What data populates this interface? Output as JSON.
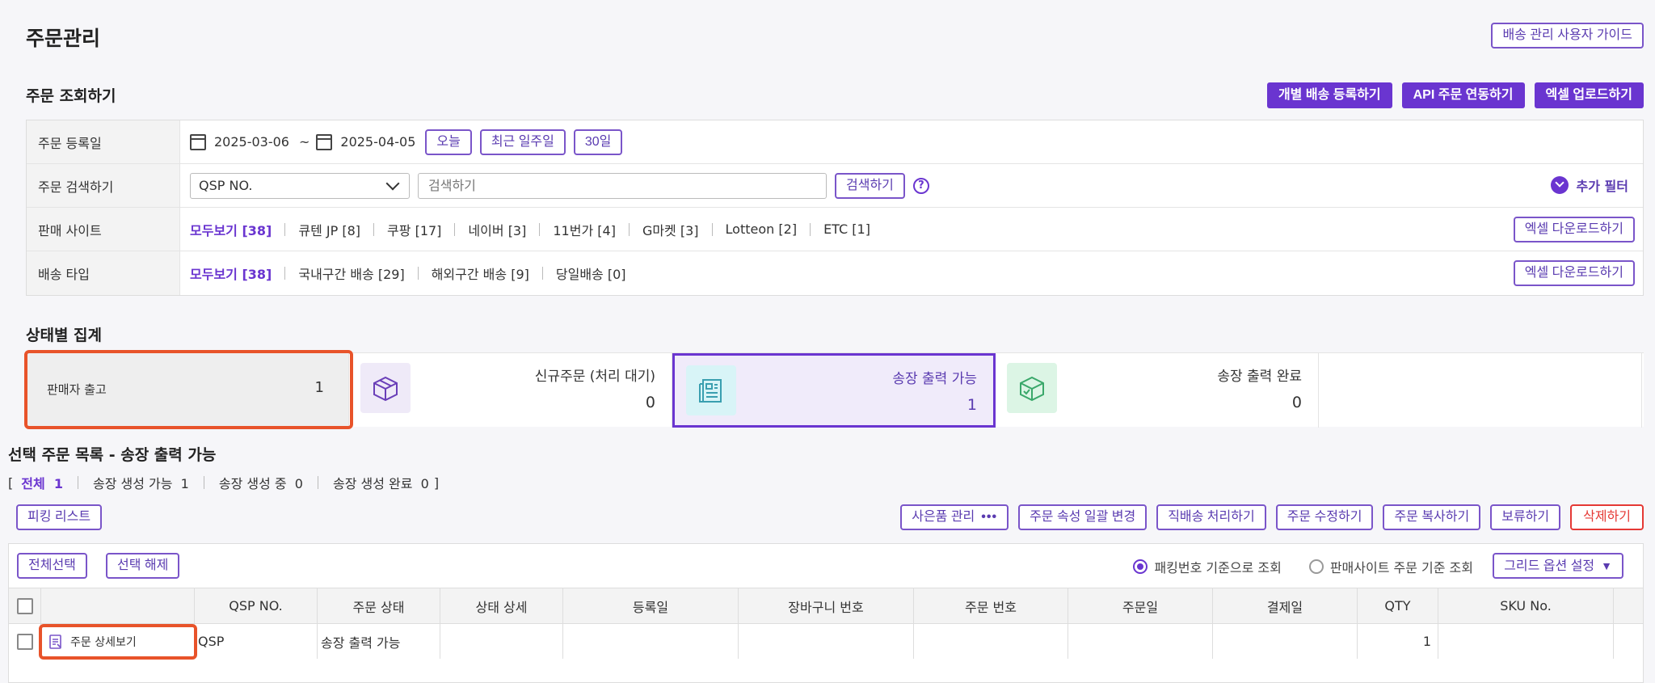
{
  "header": {
    "title": "주문관리",
    "guide_button": "배송 관리 사용자 가이드"
  },
  "search": {
    "title": "주문 조회하기",
    "actions": [
      "개별 배송 등록하기",
      "API 주문 연동하기",
      "엑셀 업로드하기"
    ],
    "date_label": "주문 등록일",
    "date_from": "2025-03-06",
    "date_sep": "~",
    "date_to": "2025-04-05",
    "quick_ranges": [
      "오늘",
      "최근 일주일",
      "30일"
    ],
    "keyword_label": "주문 검색하기",
    "keyword_type": "QSP NO.",
    "keyword_placeholder": "검색하기",
    "search_button": "검색하기",
    "help": "?",
    "more_filter": "추가 필터",
    "site_label": "판매 사이트",
    "sites": [
      {
        "label": "모두보기",
        "count": "[38]"
      },
      {
        "label": "큐텐 JP",
        "count": "[8]"
      },
      {
        "label": "쿠팡",
        "count": "[17]"
      },
      {
        "label": "네이버",
        "count": "[3]"
      },
      {
        "label": "11번가",
        "count": "[4]"
      },
      {
        "label": "G마켓",
        "count": "[3]"
      },
      {
        "label": "Lotteon",
        "count": "[2]"
      },
      {
        "label": "ETC",
        "count": "[1]"
      }
    ],
    "ship_label": "배송 타입",
    "ship_types": [
      {
        "label": "모두보기",
        "count": "[38]"
      },
      {
        "label": "국내구간 배송",
        "count": "[29]"
      },
      {
        "label": "해외구간 배송",
        "count": "[9]"
      },
      {
        "label": "당일배송",
        "count": "[0]"
      }
    ],
    "excel_download": "엑셀 다운로드하기"
  },
  "status": {
    "title": "상태별 집계",
    "seller_out": {
      "label": "판매자 출고",
      "count": "1"
    },
    "cards": [
      {
        "label": "신규주문 (처리 대기)",
        "count": "0",
        "icon": "box-icon"
      },
      {
        "label": "송장 출력 가능",
        "count": "1",
        "icon": "invoice-icon"
      },
      {
        "label": "송장 출력 완료",
        "count": "0",
        "icon": "box-check-icon"
      }
    ]
  },
  "list": {
    "title": "선택 주문 목록 - 송장 출력 가능",
    "bracket_open": "[",
    "bracket_close": "]",
    "tabs": [
      {
        "label": "전체",
        "count": "1"
      },
      {
        "label": "송장 생성 가능",
        "count": "1"
      },
      {
        "label": "송장 생성 중",
        "count": "0"
      },
      {
        "label": "송장 생성 완료",
        "count": "0"
      }
    ],
    "picking_button": "피킹 리스트",
    "gift_button": "사은품 관리",
    "gift_dots": "•••",
    "actions": [
      "주문 속성 일괄 변경",
      "직배송 처리하기",
      "주문 수정하기",
      "주문 복사하기",
      "보류하기"
    ],
    "delete_button": "삭제하기",
    "select_all": "전체선택",
    "deselect": "선택 해제",
    "radio_packing": "패킹번호 기준으로 조회",
    "radio_site": "판매사이트 주문 기준 조회",
    "grid_options": "그리드 옵션 설정",
    "columns": [
      "QSP NO.",
      "주문 상태",
      "상태 상세",
      "등록일",
      "장바구니 번호",
      "주문 번호",
      "주문일",
      "결제일",
      "QTY",
      "SKU No."
    ],
    "row": {
      "detail": "주문 상세보기",
      "qsp": "QSP",
      "status": "송장 출력 가능",
      "qty": "1"
    }
  },
  "colors": {
    "accent": "#6a35d0",
    "highlight": "#e8532a",
    "danger": "#e53935"
  }
}
